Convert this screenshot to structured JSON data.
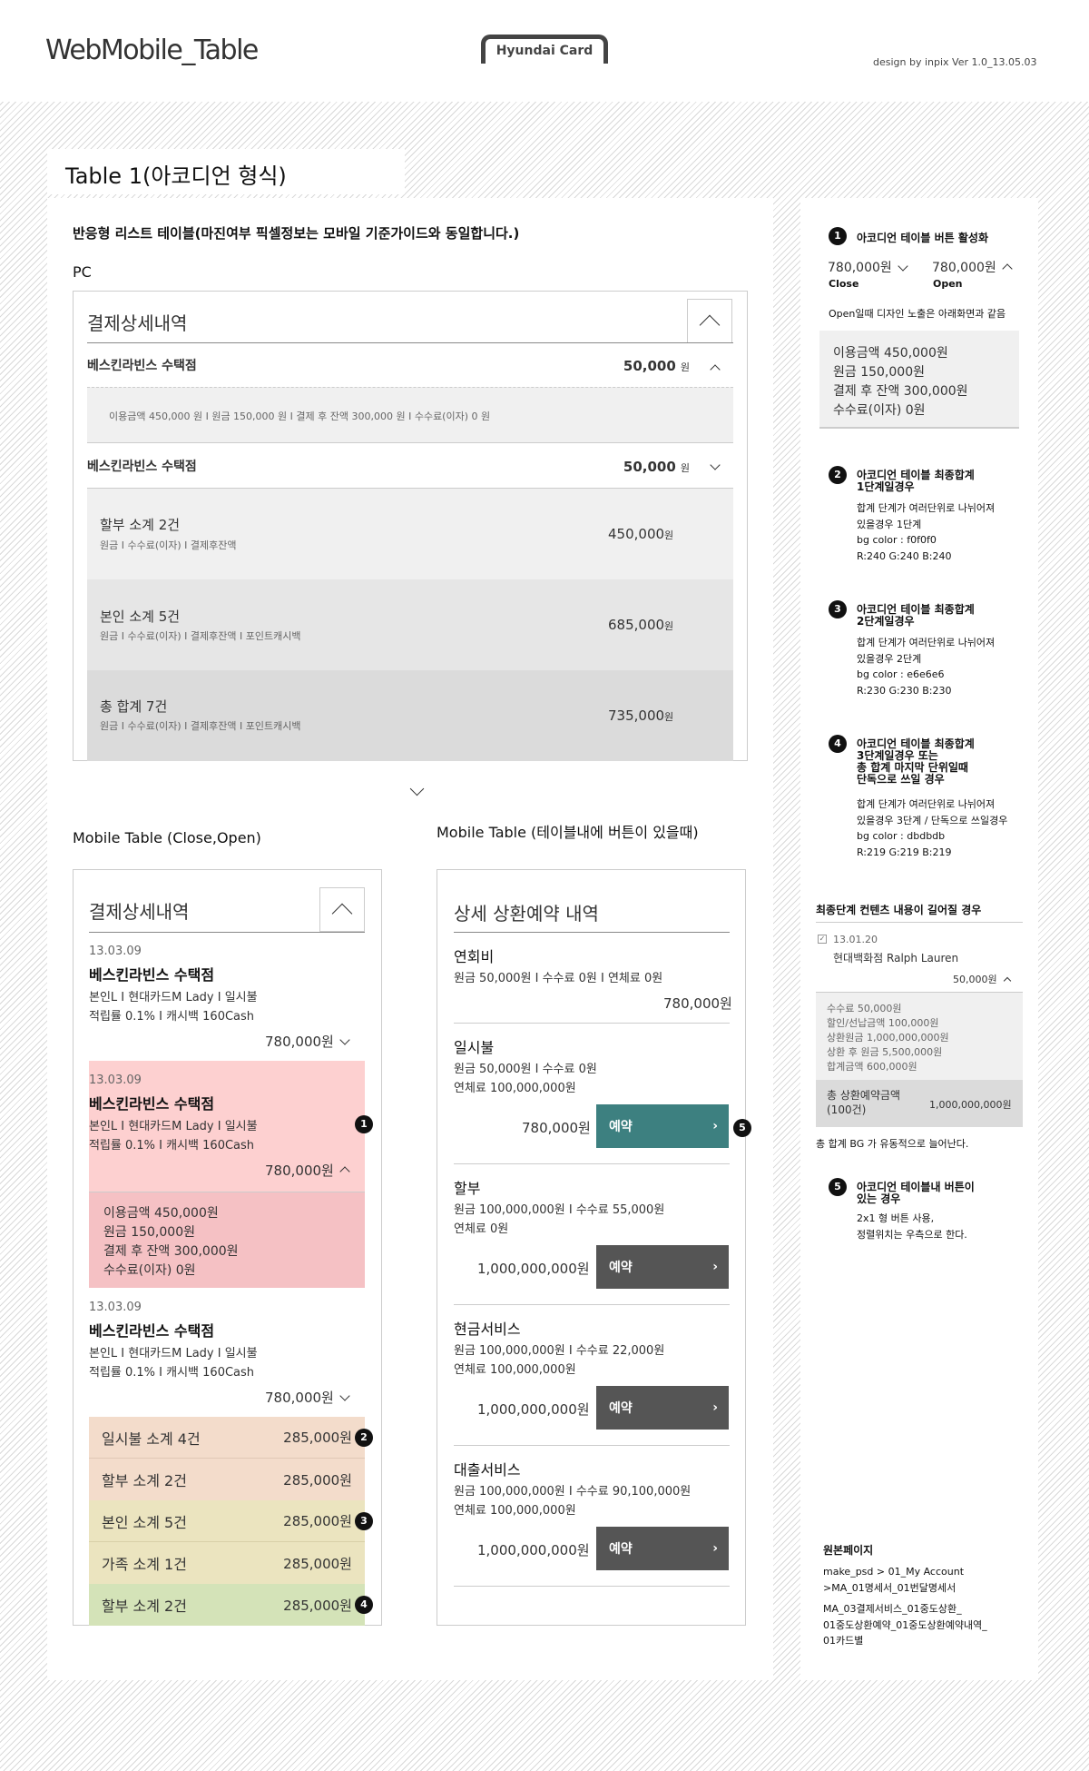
{
  "header": {
    "title": "WebMobile_Table",
    "brand": "Hyundai Card",
    "version": "design by inpix Ver 1.0_13.05.03"
  },
  "section_title": "Table 1(아코디언 형식)",
  "intro": "반응형 리스트 테이블(마진여부 픽셀정보는 모바일 기준가이드와 동일합니다.)",
  "pc": {
    "label": "PC",
    "table_title": "결제상세내역",
    "row1": {
      "name": "베스킨라빈스 수택점",
      "amount": "50,000",
      "unit": "원"
    },
    "row1_detail": "이용금액 450,000 원  I  원금 150,000 원  I  결제 후 잔액 300,000 원  I  수수료(이자) 0 원",
    "row2": {
      "name": "베스킨라빈스 수택점",
      "amount": "50,000",
      "unit": "원"
    },
    "sub1": {
      "title": "할부 소계 2건",
      "detail": "원금  I  수수료(이자)  I  결제후잔액",
      "amount": "450,000",
      "unit": "원"
    },
    "sub2": {
      "title": "본인 소계 5건",
      "detail": "원금  I  수수료(이자)  I  결제후잔액  I  포인트캐시백",
      "amount": "685,000",
      "unit": "원"
    },
    "sub3": {
      "title": "총 합계 7건",
      "detail": "원금  I  수수료(이자)  I  결제후잔액  I  포인트캐시백",
      "amount": "735,000",
      "unit": "원"
    }
  },
  "mobile_left": {
    "label": "Mobile Table (Close,Open)",
    "table_title": "결제상세내역",
    "item1": {
      "date": "13.03.09",
      "name": "베스킨라빈스 수택점",
      "line1": "본인L  I  현대카드M Lady  I  일시불",
      "line2": "적립률 0.1%  I  캐시백 160Cash",
      "amount": "780,000원"
    },
    "item2": {
      "date": "13.03.09",
      "name": "베스킨라빈스 수택점",
      "line1": "본인L  I  현대카드M Lady  I  일시불",
      "line2": "적립률 0.1%  I  캐시백 160Cash",
      "amount": "780,000원",
      "details": [
        "이용금액 450,000원",
        "원금 150,000원",
        "결제 후 잔액 300,000원",
        "수수료(이자) 0원"
      ]
    },
    "item3": {
      "date": "13.03.09",
      "name": "베스킨라빈스 수택점",
      "line1": "본인L  I  현대카드M Lady  I  일시불",
      "line2": "적립률 0.1%  I  캐시백 160Cash",
      "amount": "780,000원"
    },
    "subtotals": [
      {
        "label": "일시불 소계 4건",
        "amount": "285,000원",
        "bg": "#f3dccb"
      },
      {
        "label": "할부 소계 2건",
        "amount": "285,000원",
        "bg": "#f3dccb"
      },
      {
        "label": "본인 소계 5건",
        "amount": "285,000원",
        "bg": "#ebe4bf"
      },
      {
        "label": "가족 소계 1건",
        "amount": "285,000원",
        "bg": "#ebe4bf"
      },
      {
        "label": "할부 소계 2건",
        "amount": "285,000원",
        "bg": "#d4e3b8"
      }
    ],
    "badges": [
      "1",
      "2",
      "3",
      "4"
    ]
  },
  "mobile_right": {
    "label": "Mobile Table (테이블내에 버튼이 있을때)",
    "table_title": "상세 상환예약 내역",
    "items": [
      {
        "title": "연회비",
        "line1": "원금 50,000원  I  수수료 0원  I  연체료 0원",
        "line2": "",
        "amount": "780,000원"
      },
      {
        "title": "일시불",
        "line1": "원금 50,000원  I  수수료 0원",
        "line2": "연체료 100,000,000원",
        "amount": "780,000원",
        "btn": "예약"
      },
      {
        "title": "할부",
        "line1": "원금 100,000,000원  I  수수료 55,000원",
        "line2": "연체료 0원",
        "amount": "1,000,000,000원",
        "btn": "예약"
      },
      {
        "title": "현금서비스",
        "line1": "원금 100,000,000원  I  수수료 22,000원",
        "line2": "연체료 100,000,000원",
        "amount": "1,000,000,000원",
        "btn": "예약"
      },
      {
        "title": "대출서비스",
        "line1": "원금 100,000,000원  I  수수료 90,100,000원",
        "line2": "연체료 100,000,000원",
        "amount": "1,000,000,000원",
        "btn": "예약"
      }
    ],
    "badge": "5",
    "btn_arrow": "›"
  },
  "side": {
    "n1": {
      "num": "1",
      "title": "아코디언 테이블 버튼 활성화",
      "close_amount": "780,000원",
      "close_label": "Close",
      "open_amount": "780,000원",
      "open_label": "Open",
      "desc": "Open일때 디자인 노출은 아래화면과 같음",
      "details": [
        "이용금액 450,000원",
        "원금 150,000원",
        "결제 후 잔액 300,000원",
        "수수료(이자) 0원"
      ]
    },
    "n2": {
      "num": "2",
      "title": [
        "아코디언 테이블 최종합계",
        "1단계일경우"
      ],
      "desc": [
        "합계 단계가 여러단위로 나뉘어져",
        "있을경우 1단계",
        "bg color : f0f0f0",
        "R:240 G:240 B:240"
      ]
    },
    "n3": {
      "num": "3",
      "title": [
        "아코디언 테이블 최종합계",
        "2단계일경우"
      ],
      "desc": [
        "합계 단계가 여러단위로 나뉘어져",
        "있을경우 2단계",
        "bg color : e6e6e6",
        "R:230 G:230 B:230"
      ]
    },
    "n4": {
      "num": "4",
      "title": [
        "아코디언 테이블 최종합계",
        "3단계일경우 또는",
        "총 합계 마지막 단위일때",
        "단독으로 쓰일 경우"
      ],
      "desc": [
        "합계 단계가 여러단위로 나뉘어져",
        "있을경우 3단계 / 단독으로 쓰일경우",
        "bg color : dbdbdb",
        "R:219 G:219 B:219"
      ]
    },
    "long": {
      "title": "최종단계 컨텐츠 내용이 길어질 경우",
      "date": "13.01.20",
      "store": "현대백화점 Ralph Lauren",
      "amount": "50,000원",
      "details": [
        "수수료 50,000원",
        "할인/선납금액 100,000원",
        "상환원금 1,000,000,000원",
        "상환 후 원금 5,500,000원",
        "합계금액 600,000원"
      ],
      "total_label": [
        "총 상환예약금액",
        "(100건)"
      ],
      "total_amount": "1,000,000,000원",
      "note": "총 합계 BG 가 유동적으로 늘어난다."
    },
    "n5": {
      "num": "5",
      "title": [
        "아코디언 테이블내 버튼이",
        "있는 경우"
      ],
      "desc": [
        "2x1 형 버튼 사용,",
        "정렬위치는 우측으로 한다."
      ]
    },
    "source": {
      "title": "원본페이지",
      "lines": [
        "make_psd > 01_My Account",
        ">MA_01명세서_01번달명세서",
        "MA_03결제서비스_01중도상환_",
        "01중도상환예약_01중도상환예약내역_",
        "01카드별"
      ]
    }
  }
}
